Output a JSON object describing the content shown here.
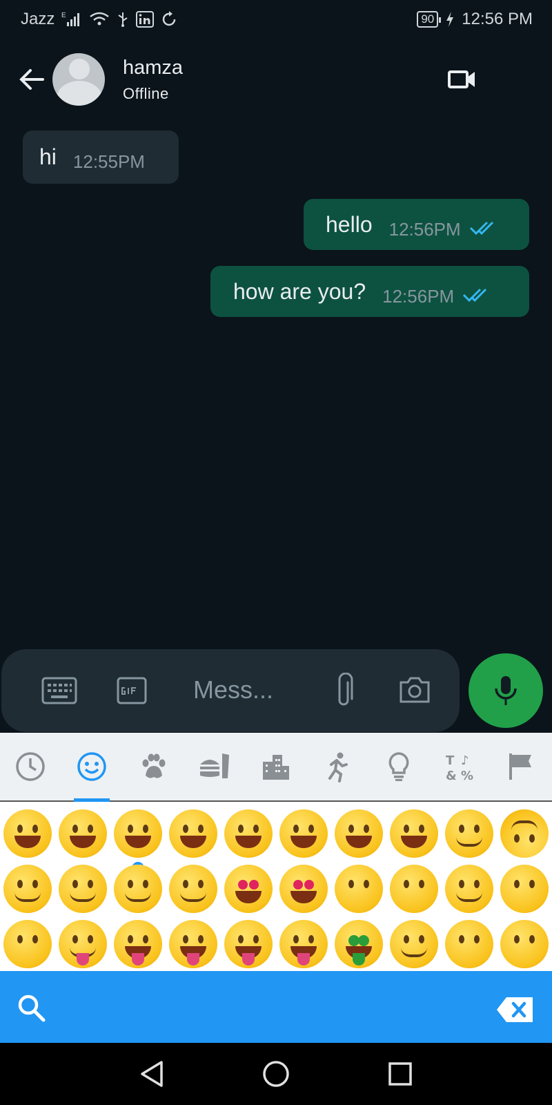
{
  "status_bar": {
    "carrier": "Jazz",
    "network_type": "E",
    "battery": "90",
    "time": "12:56 PM"
  },
  "header": {
    "contact_name": "hamza",
    "contact_status": "Offline"
  },
  "messages": [
    {
      "direction": "incoming",
      "text": "hi",
      "time": "12:55PM"
    },
    {
      "direction": "outgoing",
      "text": "hello",
      "time": "12:56PM",
      "read": true
    },
    {
      "direction": "outgoing",
      "text": "how are you?",
      "time": "12:56PM",
      "read": true
    }
  ],
  "composer": {
    "placeholder": "Mess..."
  },
  "emoji_keyboard": {
    "categories": [
      "recent-icon",
      "smileys-icon",
      "animals-icon",
      "food-icon",
      "places-icon",
      "activity-icon",
      "objects-icon",
      "symbols-icon",
      "flags-icon"
    ],
    "selected_category": "smileys-icon",
    "emoji_rows": [
      [
        "😀",
        "😃",
        "😄",
        "😁",
        "😆",
        "😅",
        "🤣",
        "😂",
        "🙂",
        "🙃"
      ],
      [
        "😉",
        "😊",
        "😇",
        "🥰",
        "😍",
        "🤩",
        "😘",
        "😗",
        "☺️",
        "😚"
      ],
      [
        "😙",
        "😋",
        "😛",
        "😜",
        "🤪",
        "😝",
        "🤑",
        "🤗",
        "🤭",
        "🤫"
      ]
    ]
  },
  "colors": {
    "background": "#0b141a",
    "outgoing_bubble": "#0d5240",
    "incoming_bubble": "#1f2c34",
    "read_ticks": "#34b7f1",
    "mic_button": "#21a049",
    "keyboard_accent": "#2196f3"
  }
}
